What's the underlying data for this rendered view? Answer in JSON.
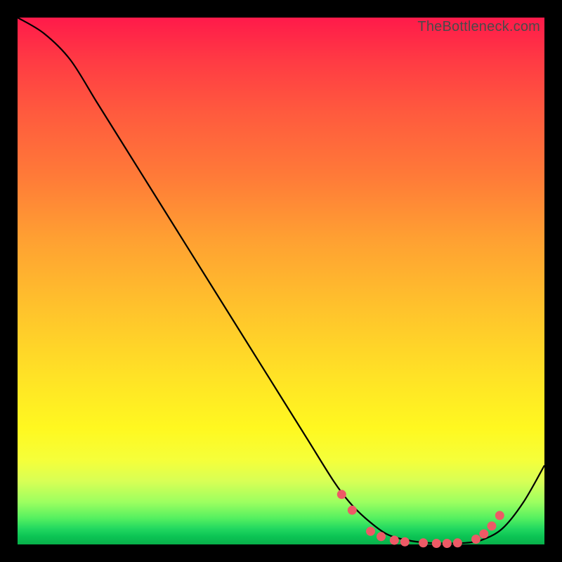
{
  "watermark": "TheBottleneck.com",
  "chart_data": {
    "type": "line",
    "title": "",
    "xlabel": "",
    "ylabel": "",
    "xlim": [
      0,
      100
    ],
    "ylim": [
      0,
      100
    ],
    "grid": false,
    "legend": false,
    "background_gradient": [
      "#ff1a4a",
      "#ff7a38",
      "#ffe226",
      "#9cff60",
      "#08b04a"
    ],
    "series": [
      {
        "name": "curve",
        "color": "#000000",
        "x": [
          0,
          5,
          10,
          15,
          20,
          25,
          30,
          35,
          40,
          45,
          50,
          55,
          60,
          63,
          66,
          70,
          74,
          78,
          82,
          85,
          88,
          92,
          96,
          100
        ],
        "y": [
          100,
          97,
          92,
          84,
          76,
          68,
          60,
          52,
          44,
          36,
          28,
          20,
          12,
          8,
          5,
          2,
          0.8,
          0.3,
          0.2,
          0.3,
          0.8,
          3,
          8,
          15
        ]
      }
    ],
    "markers": [
      {
        "x": 61.5,
        "y": 9.5
      },
      {
        "x": 63.5,
        "y": 6.5
      },
      {
        "x": 67.0,
        "y": 2.5
      },
      {
        "x": 69.0,
        "y": 1.5
      },
      {
        "x": 71.5,
        "y": 0.8
      },
      {
        "x": 73.5,
        "y": 0.5
      },
      {
        "x": 77.0,
        "y": 0.3
      },
      {
        "x": 79.5,
        "y": 0.2
      },
      {
        "x": 81.5,
        "y": 0.2
      },
      {
        "x": 83.5,
        "y": 0.3
      },
      {
        "x": 87.0,
        "y": 1.0
      },
      {
        "x": 88.5,
        "y": 2.0
      },
      {
        "x": 90.0,
        "y": 3.5
      },
      {
        "x": 91.5,
        "y": 5.5
      }
    ],
    "marker_color": "#ed5a66"
  }
}
